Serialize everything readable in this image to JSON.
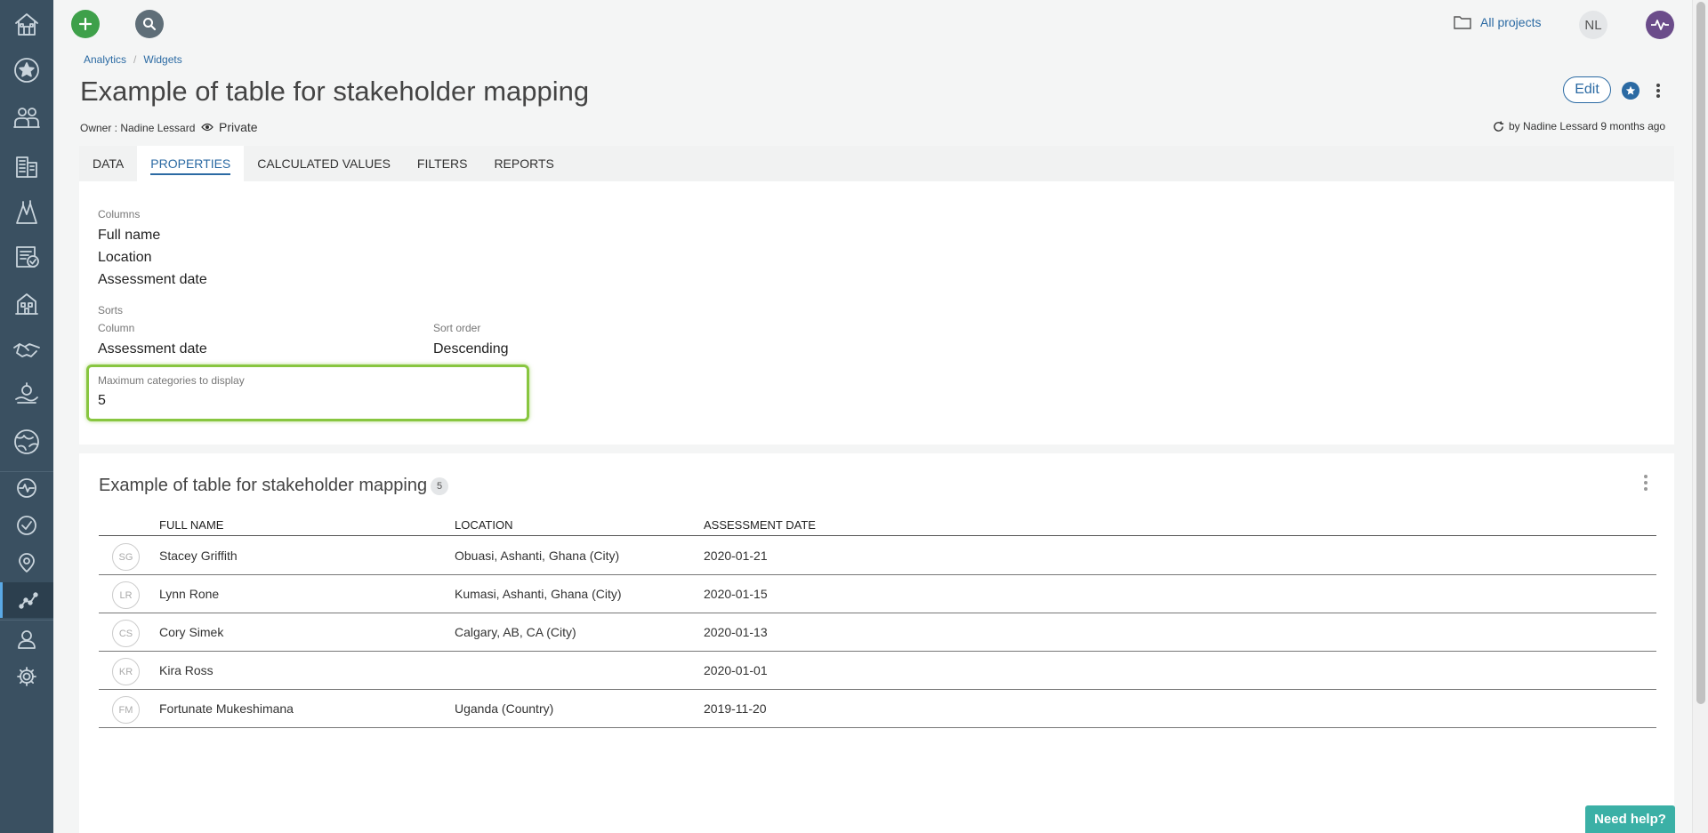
{
  "breadcrumb": [
    "Analytics",
    "Widgets"
  ],
  "page": {
    "title": "Example of table for stakeholder mapping",
    "owner": "Owner : Nadine Lessard",
    "privacy": "Private",
    "updated": "by Nadine Lessard 9 months ago",
    "edit_label": "Edit"
  },
  "header": {
    "all_projects": "All projects",
    "user_initials": "NL"
  },
  "tabs": [
    "DATA",
    "PROPERTIES",
    "CALCULATED VALUES",
    "FILTERS",
    "REPORTS"
  ],
  "active_tab": "PROPERTIES",
  "properties": {
    "columns_label": "Columns",
    "columns": [
      "Full name",
      "Location",
      "Assessment date"
    ],
    "sorts_label": "Sorts",
    "sort_column_label": "Column",
    "sort_column": "Assessment date",
    "sort_order_label": "Sort order",
    "sort_order": "Descending",
    "max_categories_label": "Maximum categories to display",
    "max_categories": "5"
  },
  "table": {
    "title": "Example of table for stakeholder mapping",
    "count": "5",
    "headers": [
      "FULL NAME",
      "LOCATION",
      "ASSESSMENT DATE"
    ],
    "rows": [
      {
        "initials": "SG",
        "name": "Stacey Griffith",
        "location": "Obuasi, Ashanti, Ghana (City)",
        "date": "2020-01-21"
      },
      {
        "initials": "LR",
        "name": "Lynn Rone",
        "location": "Kumasi, Ashanti, Ghana (City)",
        "date": "2020-01-15"
      },
      {
        "initials": "CS",
        "name": "Cory Simek",
        "location": "Calgary, AB, CA (City)",
        "date": "2020-01-13"
      },
      {
        "initials": "KR",
        "name": "Kira Ross",
        "location": "",
        "date": "2020-01-01"
      },
      {
        "initials": "FM",
        "name": "Fortunate Mukeshimana",
        "location": "Uganda (Country)",
        "date": "2019-11-20"
      }
    ]
  },
  "help_label": "Need help?",
  "sidebar_icons": [
    "home-icon",
    "star-icon",
    "stakeholders-icon",
    "organizations-icon",
    "projects-icon",
    "tasks-icon",
    "buildings-icon",
    "agreements-icon",
    "grievances-icon",
    "globe-icon",
    "activity-icon",
    "check-icon",
    "location-icon",
    "analytics-icon",
    "user-icon",
    "settings-icon"
  ],
  "colors": {
    "sidebar": "#3a5061",
    "accent": "#2b6aa3",
    "add": "#3ea04a",
    "highlight": "#88c640",
    "help": "#3bb0a6",
    "pulse": "#6b4c8a"
  }
}
